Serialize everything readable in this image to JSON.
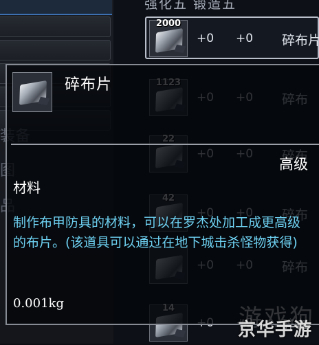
{
  "background": {
    "column_header": "强化五 锻造五",
    "left_labels": [
      "装备",
      "图",
      "品"
    ],
    "rows": [
      {
        "qty": "2000",
        "stat_a": "+0",
        "stat_b": "+0",
        "name": "碎布片",
        "selected": true
      },
      {
        "qty": "1123",
        "stat_a": "+0",
        "stat_b": "+0",
        "name": "碎布"
      },
      {
        "qty": "22",
        "stat_a": "+0",
        "stat_b": "+0",
        "name": "碎布"
      },
      {
        "qty": "42",
        "stat_a": "+0",
        "stat_b": "+0",
        "name": "碎布"
      },
      {
        "qty": "",
        "stat_a": "+0",
        "stat_b": "+0",
        "name": "碎布"
      },
      {
        "qty": "14",
        "stat_a": "+0",
        "stat_b": "+0",
        "name": "碎布"
      }
    ]
  },
  "tooltip": {
    "item_name": "碎布片",
    "icon": "cloth-shard-icon",
    "grade": "高级",
    "type": "材料",
    "description": "制作布甲防具的材料，可以在罗杰处加工成更高级的布片。(该道具可以通过在地下城击杀怪物获得)",
    "weight": "0.001kg"
  },
  "watermark": {
    "ghost": "游戏狗",
    "text": "京华手游"
  },
  "colors": {
    "description": "#6ed1f2",
    "border": "#868b94",
    "tab_accent": "#3c70b0"
  }
}
